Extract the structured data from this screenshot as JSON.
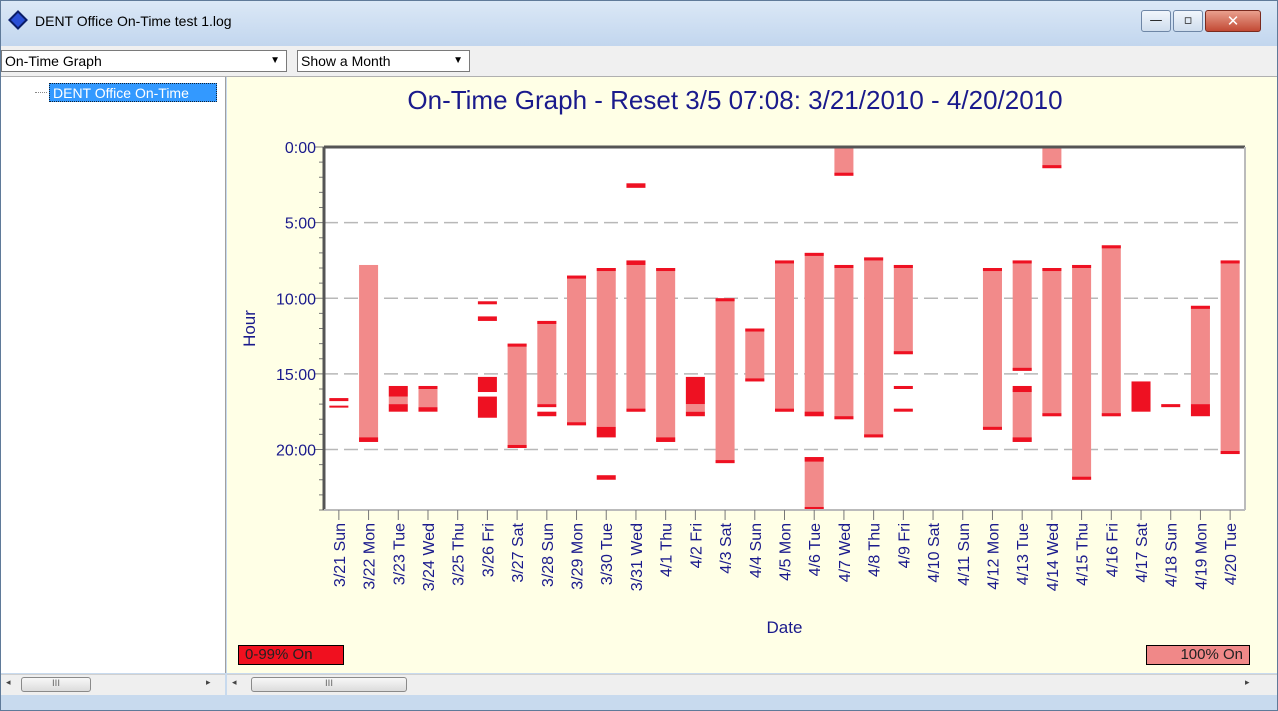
{
  "window": {
    "title": "DENT Office On-Time test 1.log"
  },
  "controls": {
    "minimize": "—",
    "maximize": "▫",
    "close": "✕"
  },
  "toolbar": {
    "graph_select": "On-Time Graph",
    "range_select": "Show a Month"
  },
  "sidebar": {
    "tree_item": "DENT Office On-Time"
  },
  "scroll": {
    "left_arrow": "◂",
    "right_arrow": "▸",
    "thumb_grip": "III"
  },
  "legend": {
    "partial": "0-99% On",
    "full": "100% On"
  },
  "colors": {
    "full": "#f28a8a",
    "partial": "#ee1122",
    "title": "#1a1a8c"
  },
  "chart_data": {
    "type": "range-bar",
    "title": "On-Time Graph - Reset 3/5 07:08:  3/21/2010 - 4/20/2010",
    "xlabel": "Date",
    "ylabel": "Hour",
    "y_inverted": true,
    "ylim": [
      0,
      24
    ],
    "y_ticks": [
      "0:00",
      "5:00",
      "10:00",
      "15:00",
      "20:00"
    ],
    "categories": [
      "3/21 Sun",
      "3/22 Mon",
      "3/23 Tue",
      "3/24 Wed",
      "3/25 Thu",
      "3/26 Fri",
      "3/27 Sat",
      "3/28 Sun",
      "3/29 Mon",
      "3/30 Tue",
      "3/31 Wed",
      "4/1 Thu",
      "4/2 Fri",
      "4/3 Sat",
      "4/4 Sun",
      "4/5 Mon",
      "4/6 Tue",
      "4/7 Wed",
      "4/8 Thu",
      "4/9 Fri",
      "4/10 Sat",
      "4/11 Sun",
      "4/12 Mon",
      "4/13 Tue",
      "4/14 Wed",
      "4/15 Thu",
      "4/16 Fri",
      "4/17 Sat",
      "4/18 Sun",
      "4/19 Mon",
      "4/20 Tue"
    ],
    "full_on": [
      {
        "day": 1,
        "start": 7.8,
        "end": 19.5
      },
      {
        "day": 2,
        "start": 16.5,
        "end": 17.0
      },
      {
        "day": 3,
        "start": 16.0,
        "end": 17.2
      },
      {
        "day": 6,
        "start": 13.0,
        "end": 19.9
      },
      {
        "day": 7,
        "start": 11.5,
        "end": 17.0
      },
      {
        "day": 8,
        "start": 8.5,
        "end": 18.4
      },
      {
        "day": 9,
        "start": 8.0,
        "end": 18.5
      },
      {
        "day": 10,
        "start": 7.5,
        "end": 17.5
      },
      {
        "day": 11,
        "start": 8.0,
        "end": 19.5
      },
      {
        "day": 12,
        "start": 17.0,
        "end": 17.5
      },
      {
        "day": 13,
        "start": 10.0,
        "end": 20.9
      },
      {
        "day": 14,
        "start": 12.0,
        "end": 15.5
      },
      {
        "day": 15,
        "start": 7.5,
        "end": 17.5
      },
      {
        "day": 16,
        "start": 7.0,
        "end": 17.8
      },
      {
        "day": 16,
        "start": 20.5,
        "end": 24.0
      },
      {
        "day": 17,
        "start": 0.0,
        "end": 1.9
      },
      {
        "day": 17,
        "start": 7.8,
        "end": 18.0
      },
      {
        "day": 18,
        "start": 7.3,
        "end": 19.2
      },
      {
        "day": 19,
        "start": 7.8,
        "end": 13.7
      },
      {
        "day": 22,
        "start": 8.0,
        "end": 18.7
      },
      {
        "day": 23,
        "start": 7.5,
        "end": 14.8
      },
      {
        "day": 23,
        "start": 16.0,
        "end": 19.5
      },
      {
        "day": 24,
        "start": 0.0,
        "end": 1.4
      },
      {
        "day": 24,
        "start": 8.0,
        "end": 17.8
      },
      {
        "day": 25,
        "start": 7.8,
        "end": 22.0
      },
      {
        "day": 26,
        "start": 6.5,
        "end": 17.8
      },
      {
        "day": 29,
        "start": 10.5,
        "end": 17.0
      },
      {
        "day": 30,
        "start": 7.5,
        "end": 20.3
      }
    ],
    "partial_on": [
      {
        "day": 0,
        "start": 16.6,
        "end": 16.8
      },
      {
        "day": 0,
        "start": 17.1,
        "end": 17.2
      },
      {
        "day": 1,
        "start": 19.2,
        "end": 19.5
      },
      {
        "day": 2,
        "start": 15.8,
        "end": 16.5
      },
      {
        "day": 2,
        "start": 17.0,
        "end": 17.5
      },
      {
        "day": 3,
        "start": 15.8,
        "end": 16.0
      },
      {
        "day": 3,
        "start": 17.2,
        "end": 17.5
      },
      {
        "day": 5,
        "start": 10.2,
        "end": 10.4
      },
      {
        "day": 5,
        "start": 11.2,
        "end": 11.5
      },
      {
        "day": 5,
        "start": 15.2,
        "end": 16.2
      },
      {
        "day": 5,
        "start": 16.5,
        "end": 17.9
      },
      {
        "day": 6,
        "start": 13.0,
        "end": 13.2
      },
      {
        "day": 6,
        "start": 19.7,
        "end": 19.9
      },
      {
        "day": 7,
        "start": 11.5,
        "end": 11.7
      },
      {
        "day": 7,
        "start": 17.0,
        "end": 17.2
      },
      {
        "day": 7,
        "start": 17.5,
        "end": 17.8
      },
      {
        "day": 8,
        "start": 8.5,
        "end": 8.7
      },
      {
        "day": 8,
        "start": 18.2,
        "end": 18.4
      },
      {
        "day": 9,
        "start": 8.0,
        "end": 8.2
      },
      {
        "day": 9,
        "start": 18.5,
        "end": 19.2
      },
      {
        "day": 9,
        "start": 21.7,
        "end": 22.0
      },
      {
        "day": 10,
        "start": 2.4,
        "end": 2.7
      },
      {
        "day": 10,
        "start": 7.5,
        "end": 7.8
      },
      {
        "day": 10,
        "start": 17.3,
        "end": 17.5
      },
      {
        "day": 11,
        "start": 8.0,
        "end": 8.2
      },
      {
        "day": 11,
        "start": 19.2,
        "end": 19.5
      },
      {
        "day": 12,
        "start": 15.2,
        "end": 17.0
      },
      {
        "day": 12,
        "start": 17.5,
        "end": 17.8
      },
      {
        "day": 13,
        "start": 10.0,
        "end": 10.2
      },
      {
        "day": 13,
        "start": 20.7,
        "end": 20.9
      },
      {
        "day": 14,
        "start": 12.0,
        "end": 12.2
      },
      {
        "day": 14,
        "start": 15.3,
        "end": 15.5
      },
      {
        "day": 15,
        "start": 7.5,
        "end": 7.7
      },
      {
        "day": 15,
        "start": 17.3,
        "end": 17.5
      },
      {
        "day": 16,
        "start": 7.0,
        "end": 7.2
      },
      {
        "day": 16,
        "start": 17.5,
        "end": 17.8
      },
      {
        "day": 16,
        "start": 20.5,
        "end": 20.8
      },
      {
        "day": 16,
        "start": 23.8,
        "end": 24.0
      },
      {
        "day": 17,
        "start": 1.7,
        "end": 1.9
      },
      {
        "day": 17,
        "start": 7.8,
        "end": 8.0
      },
      {
        "day": 17,
        "start": 17.8,
        "end": 18.0
      },
      {
        "day": 18,
        "start": 7.3,
        "end": 7.5
      },
      {
        "day": 18,
        "start": 19.0,
        "end": 19.2
      },
      {
        "day": 19,
        "start": 7.8,
        "end": 8.0
      },
      {
        "day": 19,
        "start": 13.5,
        "end": 13.7
      },
      {
        "day": 19,
        "start": 15.8,
        "end": 16.0
      },
      {
        "day": 19,
        "start": 17.3,
        "end": 17.5
      },
      {
        "day": 22,
        "start": 8.0,
        "end": 8.2
      },
      {
        "day": 22,
        "start": 18.5,
        "end": 18.7
      },
      {
        "day": 23,
        "start": 7.5,
        "end": 7.7
      },
      {
        "day": 23,
        "start": 14.6,
        "end": 14.8
      },
      {
        "day": 23,
        "start": 15.8,
        "end": 16.2
      },
      {
        "day": 23,
        "start": 19.2,
        "end": 19.5
      },
      {
        "day": 24,
        "start": 1.2,
        "end": 1.4
      },
      {
        "day": 24,
        "start": 8.0,
        "end": 8.2
      },
      {
        "day": 24,
        "start": 17.6,
        "end": 17.8
      },
      {
        "day": 25,
        "start": 7.8,
        "end": 8.0
      },
      {
        "day": 25,
        "start": 21.8,
        "end": 22.0
      },
      {
        "day": 26,
        "start": 6.5,
        "end": 6.7
      },
      {
        "day": 26,
        "start": 17.6,
        "end": 17.8
      },
      {
        "day": 27,
        "start": 15.5,
        "end": 17.5
      },
      {
        "day": 28,
        "start": 17.0,
        "end": 17.2
      },
      {
        "day": 29,
        "start": 10.5,
        "end": 10.7
      },
      {
        "day": 29,
        "start": 17.0,
        "end": 17.8
      },
      {
        "day": 30,
        "start": 7.5,
        "end": 7.7
      },
      {
        "day": 30,
        "start": 20.1,
        "end": 20.3
      }
    ]
  }
}
